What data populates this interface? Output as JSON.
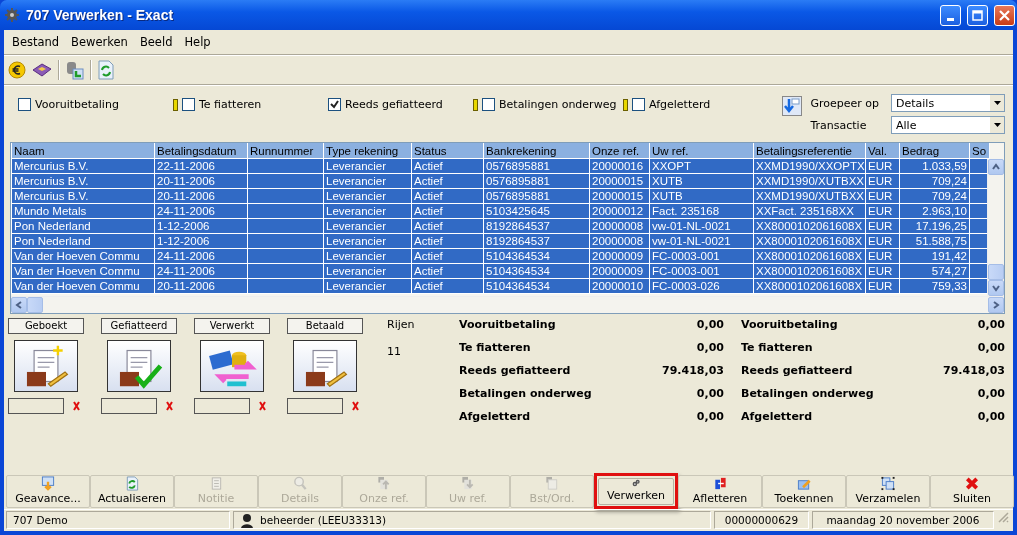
{
  "window": {
    "title": "707 Verwerken - Exact"
  },
  "menu": [
    "Bestand",
    "Bewerken",
    "Beeld",
    "Help"
  ],
  "filters": [
    {
      "label": "Vooruitbetaling",
      "checked": false,
      "flagged": false
    },
    {
      "label": "Te fiatteren",
      "checked": false,
      "flagged": true
    },
    {
      "label": "Reeds gefiatteerd",
      "checked": true,
      "flagged": false
    },
    {
      "label": "Betalingen onderweg",
      "checked": false,
      "flagged": true
    },
    {
      "label": "Afgeletterd",
      "checked": false,
      "flagged": true
    }
  ],
  "grouping": [
    {
      "label": "Groepeer op",
      "value": "Details"
    },
    {
      "label": "Transactie",
      "value": "Alle"
    }
  ],
  "table": {
    "columns": [
      "Naam",
      "Betalingsdatum",
      "Runnummer",
      "Type rekening",
      "Status",
      "Bankrekening",
      "Onze ref.",
      "Uw ref.",
      "Betalingsreferentie",
      "Val.",
      "Bedrag",
      "So"
    ],
    "rows": [
      {
        "selected": true,
        "cells": [
          "Mercurius B.V.",
          "22-11-2006",
          "",
          "Leverancier",
          "Actief",
          "0576895881",
          "20000016",
          "XXOPT",
          "XXMD1990/XXOPTX",
          "EUR",
          "1.033,59",
          ""
        ]
      },
      {
        "selected": true,
        "cells": [
          "Mercurius B.V.",
          "20-11-2006",
          "",
          "Leverancier",
          "Actief",
          "0576895881",
          "20000015",
          "XUTB",
          "XXMD1990/XUTBXX",
          "EUR",
          "709,24",
          ""
        ]
      },
      {
        "selected": true,
        "cells": [
          "Mercurius B.V.",
          "20-11-2006",
          "",
          "Leverancier",
          "Actief",
          "0576895881",
          "20000015",
          "XUTB",
          "XXMD1990/XUTBXX",
          "EUR",
          "709,24",
          ""
        ]
      },
      {
        "selected": true,
        "cells": [
          "Mundo Metals",
          "24-11-2006",
          "",
          "Leverancier",
          "Actief",
          "5103425645",
          "20000012",
          "Fact. 235168",
          "XXFact. 235168XX",
          "EUR",
          "2.963,10",
          ""
        ]
      },
      {
        "selected": true,
        "cells": [
          "Pon Nederland",
          "1-12-2006",
          "",
          "Leverancier",
          "Actief",
          "8192864537",
          "20000008",
          "vw-01-NL-0021",
          "XX8000102061608X",
          "EUR",
          "17.196,25",
          ""
        ]
      },
      {
        "selected": true,
        "cells": [
          "Pon Nederland",
          "1-12-2006",
          "",
          "Leverancier",
          "Actief",
          "8192864537",
          "20000008",
          "vw-01-NL-0021",
          "XX8000102061608X",
          "EUR",
          "51.588,75",
          ""
        ]
      },
      {
        "selected": true,
        "cells": [
          "Van der Hoeven Commu",
          "24-11-2006",
          "",
          "Leverancier",
          "Actief",
          "5104364534",
          "20000009",
          "FC-0003-001",
          "XX8000102061608X",
          "EUR",
          "191,42",
          ""
        ]
      },
      {
        "selected": true,
        "cells": [
          "Van der Hoeven Commu",
          "24-11-2006",
          "",
          "Leverancier",
          "Actief",
          "5104364534",
          "20000009",
          "FC-0003-001",
          "XX8000102061608X",
          "EUR",
          "574,27",
          ""
        ]
      },
      {
        "selected": true,
        "cells": [
          "Van der Hoeven Commu",
          "20-11-2006",
          "",
          "Leverancier",
          "Actief",
          "5104364534",
          "20000010",
          "FC-0003-026",
          "XX8000102061608X",
          "EUR",
          "759,33",
          ""
        ]
      }
    ]
  },
  "stages": [
    "Geboekt",
    "Gefiatteerd",
    "Verwerkt",
    "Betaald"
  ],
  "summary": {
    "rows_label": "Rijen",
    "rows_count": "11",
    "totals_left": [
      {
        "label": "Vooruitbetaling",
        "value": "0,00"
      },
      {
        "label": "Te fiatteren",
        "value": "0,00"
      },
      {
        "label": "Reeds gefiatteerd",
        "value": "79.418,03"
      },
      {
        "label": "Betalingen onderweg",
        "value": "0,00"
      },
      {
        "label": "Afgeletterd",
        "value": "0,00"
      }
    ],
    "totals_right": [
      {
        "label": "Vooruitbetaling",
        "value": "0,00"
      },
      {
        "label": "Te fiatteren",
        "value": "0,00"
      },
      {
        "label": "Reeds gefiatteerd",
        "value": "79.418,03"
      },
      {
        "label": "Betalingen onderweg",
        "value": "0,00"
      },
      {
        "label": "Afgeletterd",
        "value": "0,00"
      }
    ]
  },
  "buttons": [
    {
      "label": "Geavance...",
      "disabled": false,
      "highlighted": false
    },
    {
      "label": "Actualiseren",
      "disabled": false,
      "highlighted": false
    },
    {
      "label": "Notitie",
      "disabled": true,
      "highlighted": false
    },
    {
      "label": "Details",
      "disabled": true,
      "highlighted": false
    },
    {
      "label": "Onze ref.",
      "disabled": true,
      "highlighted": false
    },
    {
      "label": "Uw ref.",
      "disabled": true,
      "highlighted": false
    },
    {
      "label": "Bst/Ord.",
      "disabled": true,
      "highlighted": false
    },
    {
      "label": "Verwerken",
      "disabled": false,
      "highlighted": true
    },
    {
      "label": "Afletteren",
      "disabled": false,
      "highlighted": false
    },
    {
      "label": "Toekennen",
      "disabled": false,
      "highlighted": false
    },
    {
      "label": "Verzamelen",
      "disabled": false,
      "highlighted": false
    },
    {
      "label": "Sluiten",
      "disabled": false,
      "highlighted": false
    }
  ],
  "status_bar": {
    "company": "707 Demo",
    "user": "beheerder (LEEU33313)",
    "number": "00000000629",
    "date": "maandag 20 november 2006"
  }
}
